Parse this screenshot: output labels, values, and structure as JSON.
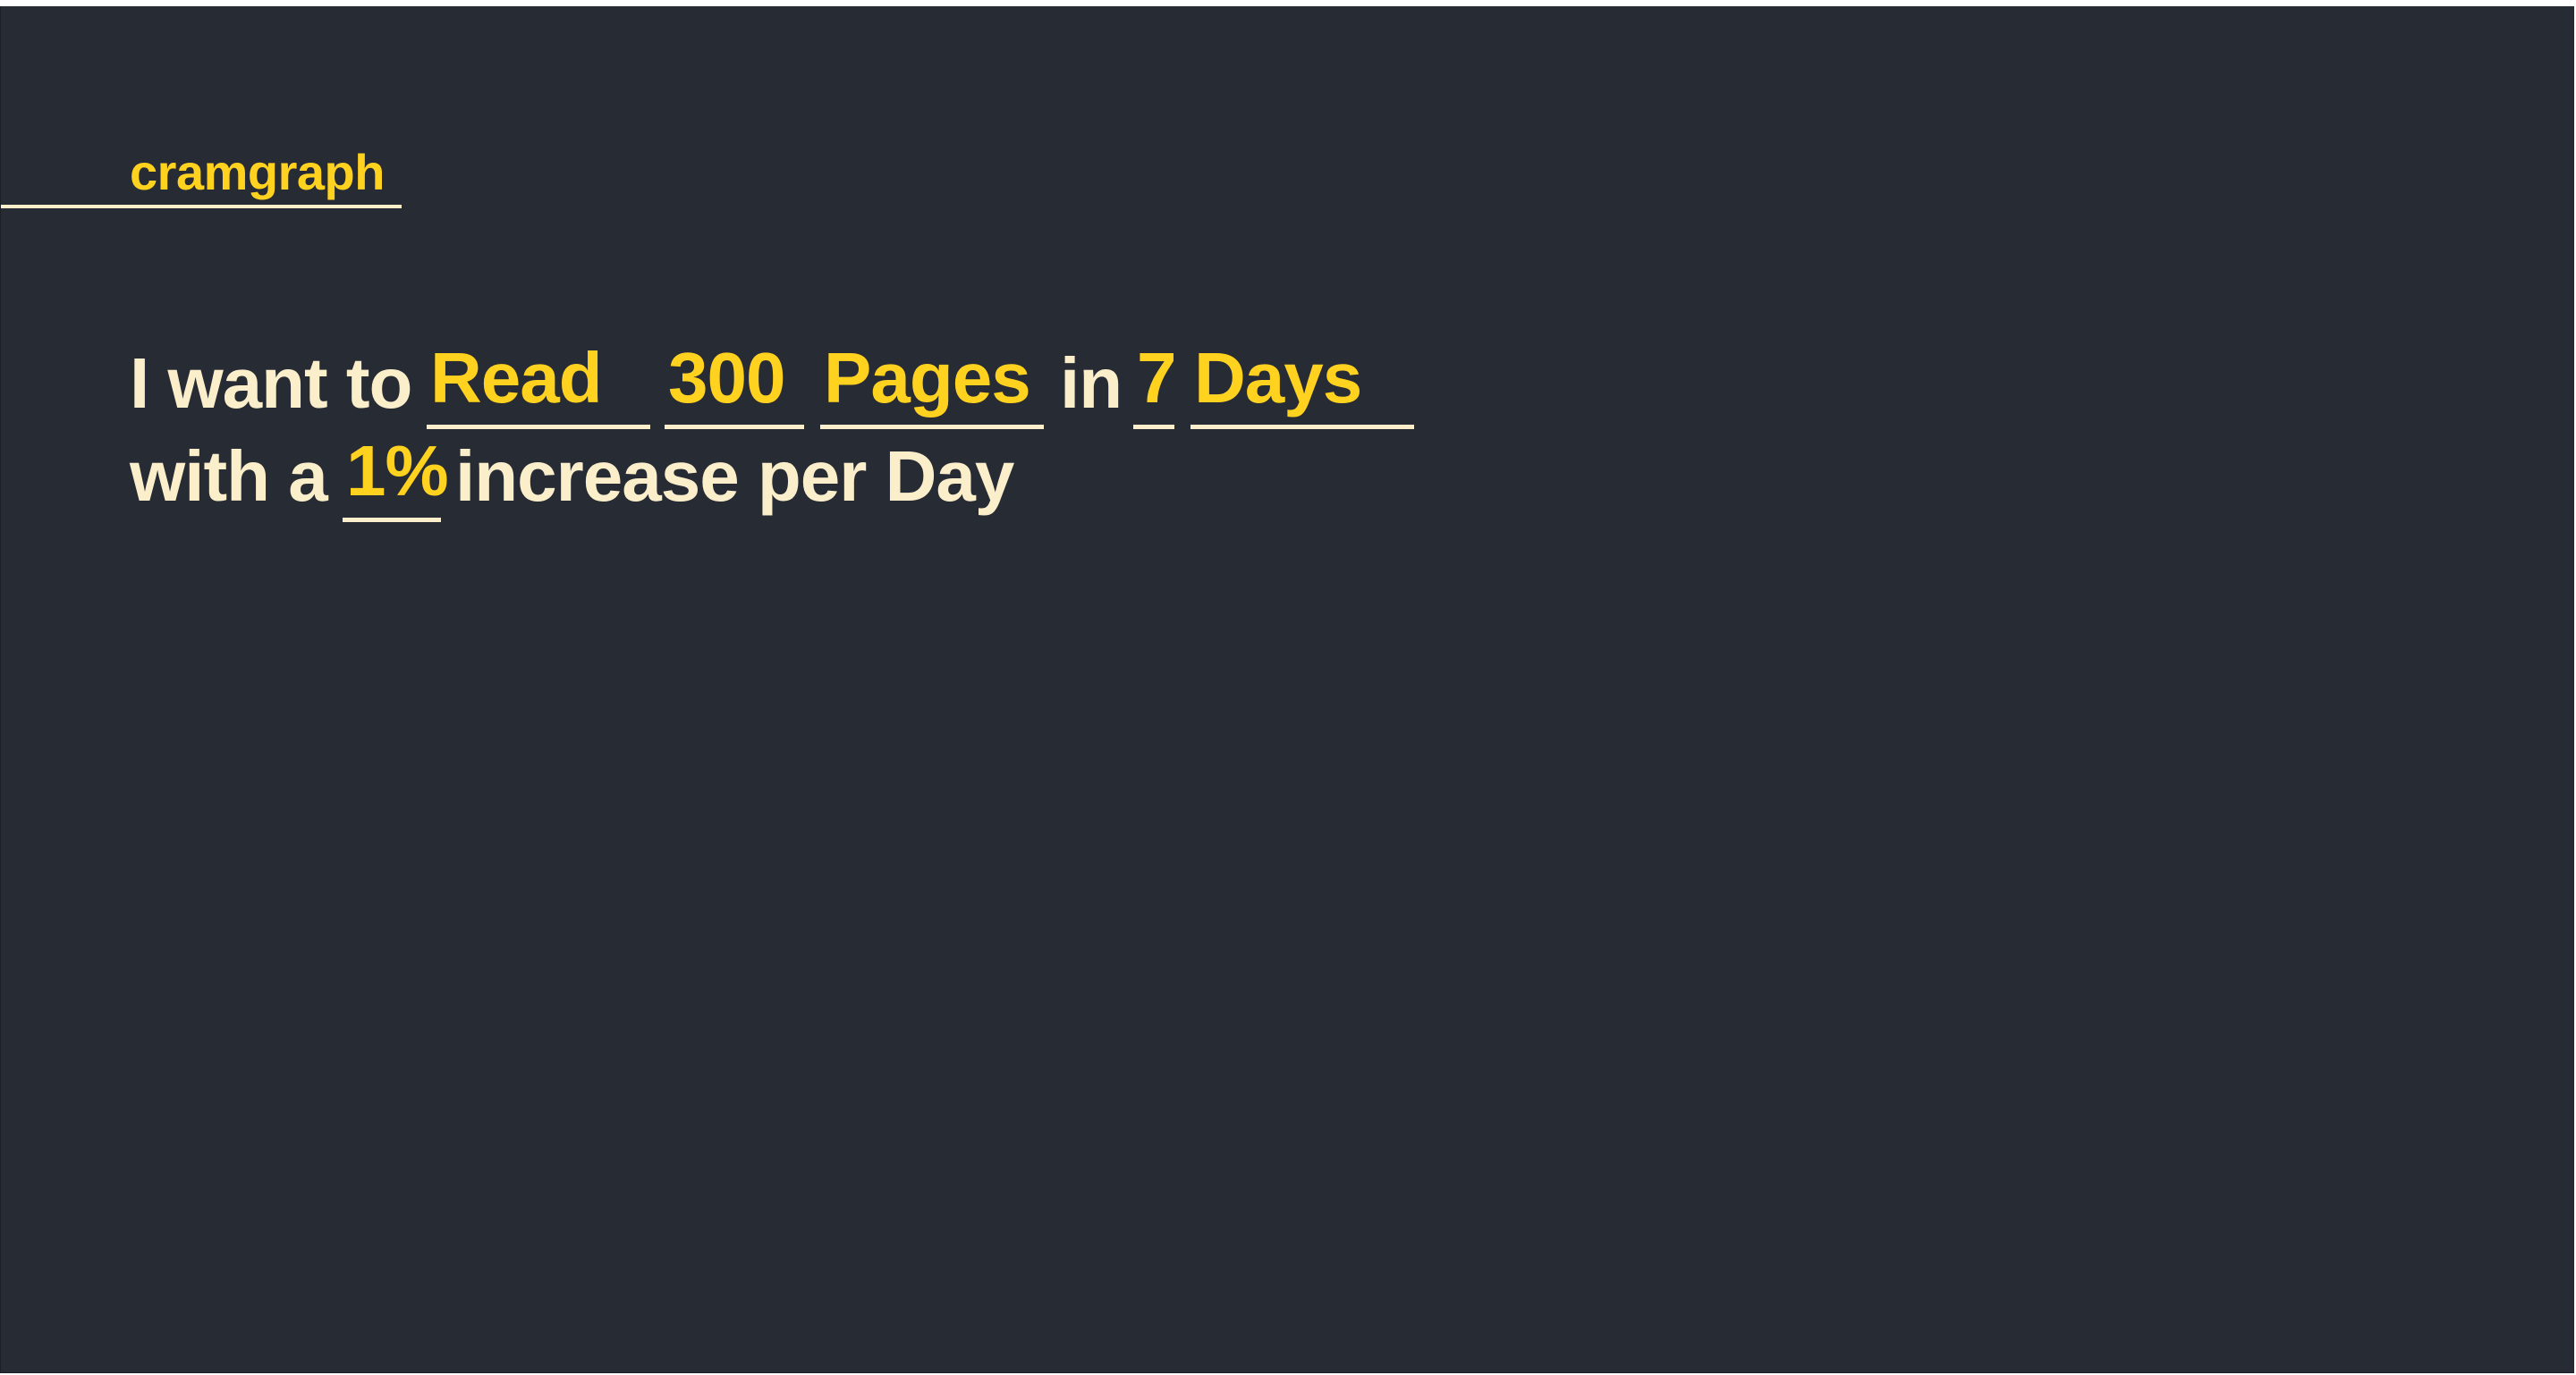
{
  "app": {
    "logo": "cramgraph"
  },
  "goal": {
    "intro": "I want to",
    "action": "Read",
    "amount": "300",
    "unit": "Pages",
    "connector_in": "in",
    "duration": "7",
    "duration_unit": "Days",
    "connector_with": "with a",
    "increase": "1%",
    "increase_suffix": "increase per Day"
  },
  "colors": {
    "background": "#272b34",
    "text": "#fbeeca",
    "accent": "#ffd21f"
  }
}
